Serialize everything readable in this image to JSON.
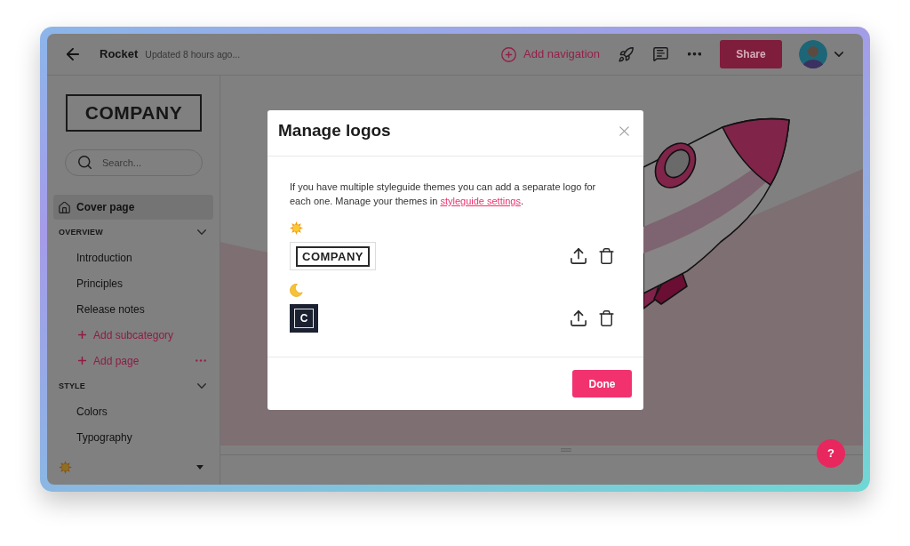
{
  "window": {
    "title": "Rocket",
    "subtitle": "Updated 8 hours ago..."
  },
  "toolbar": {
    "add_navigation": "Add navigation",
    "share": "Share"
  },
  "sidebar": {
    "logo": "COMPANY",
    "search": {
      "placeholder": "Search..."
    },
    "cover_page": {
      "label": "Cover page",
      "selected": true
    },
    "sections": [
      {
        "title": "OVERVIEW",
        "expanded": true,
        "items": [
          {
            "kind": "page",
            "label": "Introduction",
            "selected": false,
            "menu": false
          },
          {
            "kind": "page",
            "label": "Principles",
            "selected": false,
            "menu": false
          },
          {
            "kind": "page",
            "label": "Release notes",
            "selected": false,
            "menu": false
          },
          {
            "kind": "add",
            "label": "Add subcategory",
            "selected": false,
            "menu": false
          },
          {
            "kind": "add",
            "label": "Add page",
            "selected": false,
            "menu": true
          }
        ]
      },
      {
        "title": "STYLE",
        "expanded": true,
        "items": [
          {
            "kind": "page",
            "label": "Colors",
            "selected": false,
            "menu": false
          },
          {
            "kind": "page",
            "label": "Typography",
            "selected": false,
            "menu": false
          }
        ]
      }
    ],
    "theme_switcher": {
      "kind": "light"
    }
  },
  "dialog": {
    "title": "Manage logos",
    "description": "If you have multiple styleguide themes you can add a separate logo for each one. Manage your themes in ",
    "link": "styleguide settings",
    "description_end": ".",
    "themes": [
      {
        "kind": "light",
        "logo": "COMPANY"
      },
      {
        "kind": "dark",
        "logo": "C"
      }
    ],
    "done": "Done"
  },
  "help": {
    "label": "?"
  }
}
